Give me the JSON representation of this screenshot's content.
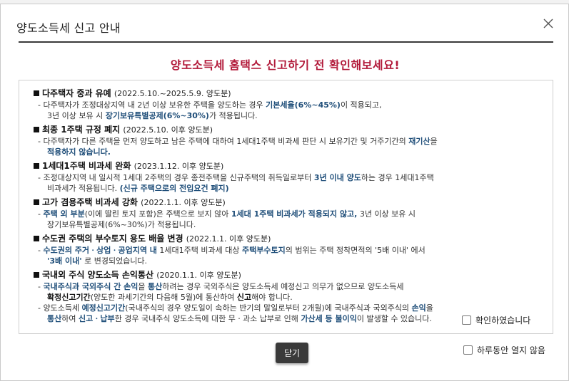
{
  "dialog": {
    "title": "양도소득세 신고 안내",
    "subtitle": "양도소득세 홈택스 신고하기 전 확인해보세요!",
    "close_icon": "close-icon"
  },
  "sections": [
    {
      "title": "다주택자 중과 유예",
      "date": "(2022.5.10.~2025.5.9. 양도분)",
      "lines": [
        {
          "indent": false,
          "parts": [
            {
              "t": "- 다주택자가 조정대상지역 내 2년 이상 보유한 주택을 양도하는 경우 "
            },
            {
              "t": "기본세율(6%~45%)",
              "s": "b"
            },
            {
              "t": "이 적용되고,"
            }
          ]
        },
        {
          "indent": true,
          "parts": [
            {
              "t": "3년 이상 보유 시 "
            },
            {
              "t": "장기보유특별공제(6%~30%)",
              "s": "b"
            },
            {
              "t": "가 적용됩니다."
            }
          ]
        }
      ]
    },
    {
      "title": "최종 1주택 규정 폐지",
      "date": "(2022.5.10. 이후 양도분)",
      "lines": [
        {
          "indent": false,
          "parts": [
            {
              "t": "- 다주택자가 다른 주택을 먼저 양도하고 남은 주택에 대하여 1세대1주택 비과세 판단 시 보유기간 및 거주기간의 "
            },
            {
              "t": "재기산",
              "s": "b"
            },
            {
              "t": "을"
            }
          ]
        },
        {
          "indent": true,
          "parts": [
            {
              "t": "적용하지 않습니다.",
              "s": "b"
            }
          ]
        }
      ]
    },
    {
      "title": "1세대1주택 비과세 완화",
      "date": "(2023.1.12. 이후 양도분)",
      "lines": [
        {
          "indent": false,
          "parts": [
            {
              "t": "- 조정대상지역 내 일시적 1세대 2주택의 경우 종전주택을 신규주택의 취득일로부터 "
            },
            {
              "t": "3년 이내 양도",
              "s": "b"
            },
            {
              "t": "하는 경우 1세대1주택"
            }
          ]
        },
        {
          "indent": true,
          "parts": [
            {
              "t": "비과세가 적용됩니다. "
            },
            {
              "t": "(신규 주택으로의 전입요건 폐지)",
              "s": "b"
            }
          ]
        }
      ]
    },
    {
      "title": "고가 겸용주택 비과세 강화",
      "date": "(2022.1.1. 이후 양도분)",
      "lines": [
        {
          "indent": false,
          "parts": [
            {
              "t": "- "
            },
            {
              "t": "주택 외 부분",
              "s": "b"
            },
            {
              "t": "(이에 딸린 토지 포함)은 주택으로 보지 않아 "
            },
            {
              "t": "1세대 1주택 비과세가 적용되지 않고,",
              "s": "b"
            },
            {
              "t": " 3년 이상 보유 시"
            }
          ]
        },
        {
          "indent": true,
          "parts": [
            {
              "t": "장기보유특별공제(6%~30%)가 적용됩니다."
            }
          ]
        }
      ]
    },
    {
      "title": "수도권 주택의 부수토지 용도 배율 변경",
      "date": "(2022.1.1. 이후 양도분)",
      "lines": [
        {
          "indent": false,
          "parts": [
            {
              "t": "- "
            },
            {
              "t": "수도권의 주거ㆍ상업ㆍ공업지역 내",
              "s": "b"
            },
            {
              "t": " 1세대1주택 비과세 대상 "
            },
            {
              "t": "주택부수토지",
              "s": "b"
            },
            {
              "t": "의 범위는 주택 정착면적의 '5배 이내' 에서"
            }
          ]
        },
        {
          "indent": true,
          "parts": [
            {
              "t": "'3배 이내'",
              "s": "b"
            },
            {
              "t": " 로 변경되었습니다."
            }
          ]
        }
      ]
    },
    {
      "title": "국내외 주식 양도소득 손익통산",
      "date": "(2020.1.1. 이후 양도분)",
      "lines": [
        {
          "indent": false,
          "parts": [
            {
              "t": "- "
            },
            {
              "t": "국내주식과 국외주식 간 손익",
              "s": "b"
            },
            {
              "t": "을 "
            },
            {
              "t": "통산",
              "s": "b"
            },
            {
              "t": "하려는 경우 국외주식은 양도소득세 예정신고 의무가 없으므로 양도소득세"
            }
          ]
        },
        {
          "indent": true,
          "parts": [
            {
              "t": "확정신고기간",
              "s": "bk"
            },
            {
              "t": "(양도한 과세기간의 다음해 5월)에 통산하여 "
            },
            {
              "t": "신고",
              "s": "bk"
            },
            {
              "t": "해야 합니다."
            }
          ]
        },
        {
          "indent": false,
          "parts": [
            {
              "t": "- 양도소득세 "
            },
            {
              "t": "예정신고기간",
              "s": "b"
            },
            {
              "t": "(국내주식의 경우 양도일이 속하는 반기의 말일로부터 2개월)에 국내주식과 국외주식의 "
            },
            {
              "t": "손익",
              "s": "b"
            },
            {
              "t": "을"
            }
          ]
        },
        {
          "indent": true,
          "parts": [
            {
              "t": "통산",
              "s": "b"
            },
            {
              "t": "하여 "
            },
            {
              "t": "신고ㆍ납부",
              "s": "b"
            },
            {
              "t": "한 경우 국내주식 양도소득에 대한 무ㆍ과소 납부로 인해 "
            },
            {
              "t": "가산세 등 불이익",
              "s": "b"
            },
            {
              "t": "이 발생할 수 있습니다."
            }
          ]
        }
      ]
    }
  ],
  "confirm_label": "확인하였습니다",
  "close_button_label": "닫기",
  "no_more_today_label": "하루동안 열지 않음",
  "colors": {
    "accent": "#b21a3a",
    "highlight": "#1f4e79",
    "button": "#3a3a3a"
  }
}
